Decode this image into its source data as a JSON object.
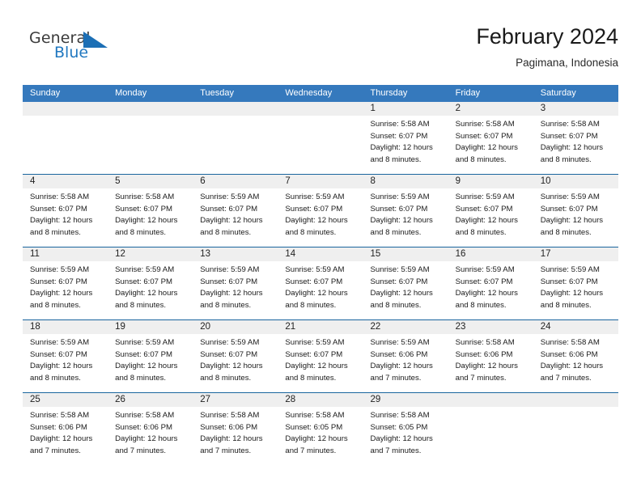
{
  "brand": {
    "name_part1": "General",
    "name_part2": "Blue",
    "triangle_icon": "triangle-icon",
    "accent_color": "#2178c0"
  },
  "header": {
    "title": "February 2024",
    "subtitle": "Pagimana, Indonesia"
  },
  "theme": {
    "header_blue": "#3579bd",
    "separator_blue": "#1a659e",
    "daynum_band": "#efefef"
  },
  "weekdays": [
    "Sunday",
    "Monday",
    "Tuesday",
    "Wednesday",
    "Thursday",
    "Friday",
    "Saturday"
  ],
  "weeks": [
    {
      "days": [
        {
          "num": "",
          "lines": []
        },
        {
          "num": "",
          "lines": []
        },
        {
          "num": "",
          "lines": []
        },
        {
          "num": "",
          "lines": []
        },
        {
          "num": "1",
          "lines": [
            "Sunrise: 5:58 AM",
            "Sunset: 6:07 PM",
            "Daylight: 12 hours",
            "and 8 minutes."
          ]
        },
        {
          "num": "2",
          "lines": [
            "Sunrise: 5:58 AM",
            "Sunset: 6:07 PM",
            "Daylight: 12 hours",
            "and 8 minutes."
          ]
        },
        {
          "num": "3",
          "lines": [
            "Sunrise: 5:58 AM",
            "Sunset: 6:07 PM",
            "Daylight: 12 hours",
            "and 8 minutes."
          ]
        }
      ]
    },
    {
      "days": [
        {
          "num": "4",
          "lines": [
            "Sunrise: 5:58 AM",
            "Sunset: 6:07 PM",
            "Daylight: 12 hours",
            "and 8 minutes."
          ]
        },
        {
          "num": "5",
          "lines": [
            "Sunrise: 5:58 AM",
            "Sunset: 6:07 PM",
            "Daylight: 12 hours",
            "and 8 minutes."
          ]
        },
        {
          "num": "6",
          "lines": [
            "Sunrise: 5:59 AM",
            "Sunset: 6:07 PM",
            "Daylight: 12 hours",
            "and 8 minutes."
          ]
        },
        {
          "num": "7",
          "lines": [
            "Sunrise: 5:59 AM",
            "Sunset: 6:07 PM",
            "Daylight: 12 hours",
            "and 8 minutes."
          ]
        },
        {
          "num": "8",
          "lines": [
            "Sunrise: 5:59 AM",
            "Sunset: 6:07 PM",
            "Daylight: 12 hours",
            "and 8 minutes."
          ]
        },
        {
          "num": "9",
          "lines": [
            "Sunrise: 5:59 AM",
            "Sunset: 6:07 PM",
            "Daylight: 12 hours",
            "and 8 minutes."
          ]
        },
        {
          "num": "10",
          "lines": [
            "Sunrise: 5:59 AM",
            "Sunset: 6:07 PM",
            "Daylight: 12 hours",
            "and 8 minutes."
          ]
        }
      ]
    },
    {
      "days": [
        {
          "num": "11",
          "lines": [
            "Sunrise: 5:59 AM",
            "Sunset: 6:07 PM",
            "Daylight: 12 hours",
            "and 8 minutes."
          ]
        },
        {
          "num": "12",
          "lines": [
            "Sunrise: 5:59 AM",
            "Sunset: 6:07 PM",
            "Daylight: 12 hours",
            "and 8 minutes."
          ]
        },
        {
          "num": "13",
          "lines": [
            "Sunrise: 5:59 AM",
            "Sunset: 6:07 PM",
            "Daylight: 12 hours",
            "and 8 minutes."
          ]
        },
        {
          "num": "14",
          "lines": [
            "Sunrise: 5:59 AM",
            "Sunset: 6:07 PM",
            "Daylight: 12 hours",
            "and 8 minutes."
          ]
        },
        {
          "num": "15",
          "lines": [
            "Sunrise: 5:59 AM",
            "Sunset: 6:07 PM",
            "Daylight: 12 hours",
            "and 8 minutes."
          ]
        },
        {
          "num": "16",
          "lines": [
            "Sunrise: 5:59 AM",
            "Sunset: 6:07 PM",
            "Daylight: 12 hours",
            "and 8 minutes."
          ]
        },
        {
          "num": "17",
          "lines": [
            "Sunrise: 5:59 AM",
            "Sunset: 6:07 PM",
            "Daylight: 12 hours",
            "and 8 minutes."
          ]
        }
      ]
    },
    {
      "days": [
        {
          "num": "18",
          "lines": [
            "Sunrise: 5:59 AM",
            "Sunset: 6:07 PM",
            "Daylight: 12 hours",
            "and 8 minutes."
          ]
        },
        {
          "num": "19",
          "lines": [
            "Sunrise: 5:59 AM",
            "Sunset: 6:07 PM",
            "Daylight: 12 hours",
            "and 8 minutes."
          ]
        },
        {
          "num": "20",
          "lines": [
            "Sunrise: 5:59 AM",
            "Sunset: 6:07 PM",
            "Daylight: 12 hours",
            "and 8 minutes."
          ]
        },
        {
          "num": "21",
          "lines": [
            "Sunrise: 5:59 AM",
            "Sunset: 6:07 PM",
            "Daylight: 12 hours",
            "and 8 minutes."
          ]
        },
        {
          "num": "22",
          "lines": [
            "Sunrise: 5:59 AM",
            "Sunset: 6:06 PM",
            "Daylight: 12 hours",
            "and 7 minutes."
          ]
        },
        {
          "num": "23",
          "lines": [
            "Sunrise: 5:58 AM",
            "Sunset: 6:06 PM",
            "Daylight: 12 hours",
            "and 7 minutes."
          ]
        },
        {
          "num": "24",
          "lines": [
            "Sunrise: 5:58 AM",
            "Sunset: 6:06 PM",
            "Daylight: 12 hours",
            "and 7 minutes."
          ]
        }
      ]
    },
    {
      "days": [
        {
          "num": "25",
          "lines": [
            "Sunrise: 5:58 AM",
            "Sunset: 6:06 PM",
            "Daylight: 12 hours",
            "and 7 minutes."
          ]
        },
        {
          "num": "26",
          "lines": [
            "Sunrise: 5:58 AM",
            "Sunset: 6:06 PM",
            "Daylight: 12 hours",
            "and 7 minutes."
          ]
        },
        {
          "num": "27",
          "lines": [
            "Sunrise: 5:58 AM",
            "Sunset: 6:06 PM",
            "Daylight: 12 hours",
            "and 7 minutes."
          ]
        },
        {
          "num": "28",
          "lines": [
            "Sunrise: 5:58 AM",
            "Sunset: 6:05 PM",
            "Daylight: 12 hours",
            "and 7 minutes."
          ]
        },
        {
          "num": "29",
          "lines": [
            "Sunrise: 5:58 AM",
            "Sunset: 6:05 PM",
            "Daylight: 12 hours",
            "and 7 minutes."
          ]
        },
        {
          "num": "",
          "lines": []
        },
        {
          "num": "",
          "lines": []
        }
      ]
    }
  ]
}
